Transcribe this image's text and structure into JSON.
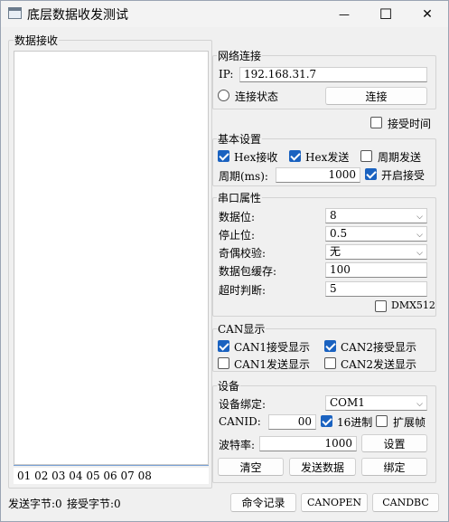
{
  "window": {
    "title": "底层数据收发测试",
    "minimize_glyph": "—",
    "maximize_glyph": "☐",
    "close_glyph": "✕"
  },
  "receive": {
    "title": "数据接收",
    "content": "",
    "send_input": "01 02 03 04 05 06 07 08"
  },
  "network": {
    "title": "网络连接",
    "ip_label": "IP:",
    "ip_value": "192.168.31.7",
    "status_label": "连接状态",
    "connect_button": "连接",
    "receive_time_label": "接受时间"
  },
  "basic": {
    "title": "基本设置",
    "hex_receive": "Hex接收",
    "hex_send": "Hex发送",
    "periodic_send": "周期发送",
    "period_label": "周期(ms):",
    "period_value": "1000",
    "open_receive": "开启接受"
  },
  "serial": {
    "title": "串口属性",
    "data_bits_label": "数据位:",
    "data_bits_value": "8",
    "stop_bits_label": "停止位:",
    "stop_bits_value": "0.5",
    "parity_label": "奇偶校验:",
    "parity_value": "无",
    "buffer_label": "数据包缓存:",
    "buffer_value": "100",
    "timeout_label": "超时判断:",
    "timeout_value": "5",
    "dmx_label": "DMX512"
  },
  "can_display": {
    "title": "CAN显示",
    "can1_recv": "CAN1接受显示",
    "can2_recv": "CAN2接受显示",
    "can1_send": "CAN1发送显示",
    "can2_send": "CAN2发送显示"
  },
  "device": {
    "title": "设备",
    "bind_label": "设备绑定:",
    "bind_value": "COM1",
    "canid_label": "CANID:",
    "canid_value": "00",
    "hex16_label": "16进制",
    "ext_frame_label": "扩展帧",
    "baud_label": "波特率:",
    "baud_value": "1000",
    "set_button": "设置",
    "clear_button": "清空",
    "send_button": "发送数据",
    "bind_button": "绑定"
  },
  "statusbar": {
    "send_bytes": "发送字节:0",
    "recv_bytes": "接受字节:0",
    "cmd_log_button": "命令记录",
    "canopen_button": "CANOPEN",
    "candbc_button": "CANDBC"
  },
  "icons": {
    "dropdown_arrow": "⌵"
  }
}
